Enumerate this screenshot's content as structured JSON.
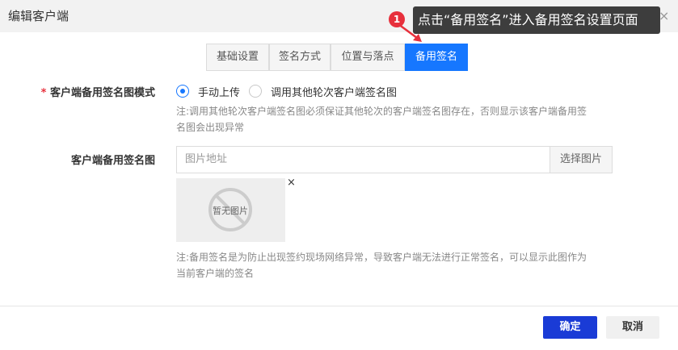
{
  "dialog": {
    "title": "编辑客户端",
    "close_glyph": "×"
  },
  "tooltip": {
    "step_number": "1",
    "text": "点击“备用签名”进入备用签名设置页面"
  },
  "tabs": [
    {
      "label": "基础设置",
      "active": false
    },
    {
      "label": "签名方式",
      "active": false
    },
    {
      "label": "位置与落点",
      "active": false
    },
    {
      "label": "备用签名",
      "active": true
    }
  ],
  "mode_field": {
    "required_mark": "*",
    "label": "客户端备用签名图模式",
    "options": [
      {
        "label": "手动上传",
        "checked": true
      },
      {
        "label": "调用其他轮次客户端签名图",
        "checked": false
      }
    ],
    "note_lines": [
      "注:调用其他轮次客户端签名图必须保证其他轮次的客户端签名图存在，否则显示该客户端备用签",
      "名图会出现异常"
    ]
  },
  "image_field": {
    "label": "客户端备用签名图",
    "placeholder": "图片地址",
    "select_button": "选择图片",
    "preview_text": "暂无图片",
    "remove_glyph": "×",
    "note_lines": [
      "注:备用签名是为防止出现签约现场网络异常，导致客户端无法进行正常签名，可以显示此图作为",
      "当前客户端的签名"
    ]
  },
  "footer": {
    "confirm_label": "确定",
    "cancel_label": "取消"
  },
  "colors": {
    "accent": "#1677ff",
    "primary_button": "#1a3bd6",
    "badge": "#e7303c",
    "tooltip_bg": "#3d3d3d"
  },
  "icons": {
    "close": "close-icon",
    "step_badge": "step-badge-icon",
    "pointer_arrow": "arrow-icon",
    "no_image": "no-image-icon"
  }
}
